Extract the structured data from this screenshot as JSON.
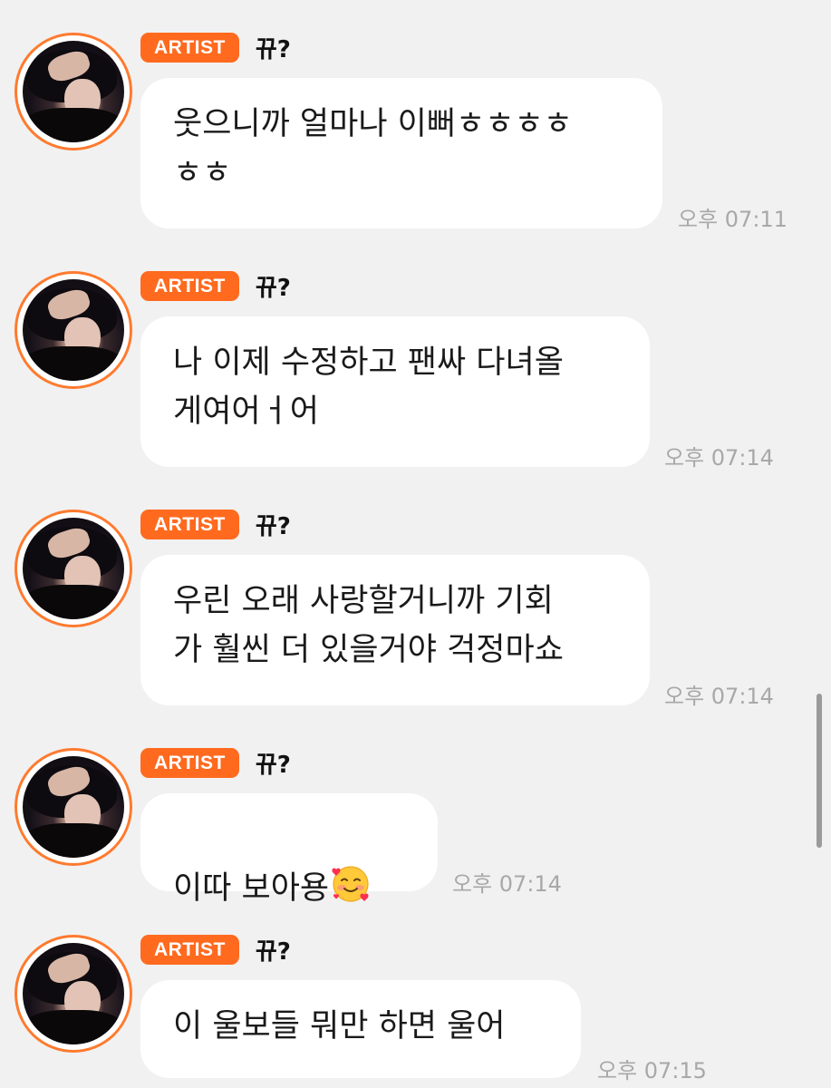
{
  "colors": {
    "background": "#f1f1f1",
    "badge": "#ff6a1f",
    "avatar_ring": "#ff7a2e",
    "bubble": "#ffffff",
    "time_text": "#a8a8a8"
  },
  "messages": [
    {
      "badge": "ARTIST",
      "name": "뀨?",
      "text": "웃으니까 얼마나 이뻐ㅎㅎㅎㅎ\nㅎㅎ",
      "time": "오후 07:11"
    },
    {
      "badge": "ARTIST",
      "name": "뀨?",
      "text": "나 이제 수정하고 팬싸 다녀올\n게여어ㅓ어",
      "time": "오후 07:14"
    },
    {
      "badge": "ARTIST",
      "name": "뀨?",
      "text": "우린 오래 사랑할거니까 기회\n가 훨씬 더 있을거야 걱정마쇼",
      "time": "오후 07:14"
    },
    {
      "badge": "ARTIST",
      "name": "뀨?",
      "text": "이따 보아용",
      "emoji": "smiling-face-with-hearts",
      "time": "오후 07:14"
    },
    {
      "badge": "ARTIST",
      "name": "뀨?",
      "text": "이 울보들 뭐만 하면 울어",
      "time": "오후 07:15"
    }
  ]
}
